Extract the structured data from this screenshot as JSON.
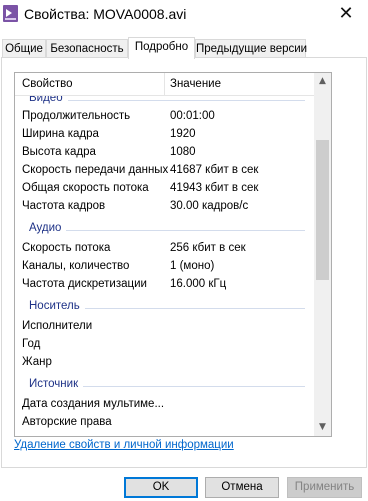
{
  "window": {
    "title": "Свойства: MOVA0008.avi"
  },
  "tabs": [
    "Общие",
    "Безопасность",
    "Подробно",
    "Предыдущие версии"
  ],
  "grid": {
    "col_property": "Свойство",
    "col_value": "Значение",
    "sections": {
      "video": "Видео",
      "audio": "Аудио",
      "media": "Носитель",
      "source": "Источник"
    },
    "video": [
      {
        "p": "Продолжительность",
        "v": "00:01:00"
      },
      {
        "p": "Ширина кадра",
        "v": "1920"
      },
      {
        "p": "Высота кадра",
        "v": "1080"
      },
      {
        "p": "Скорость передачи данных",
        "v": "41687 кбит в сек"
      },
      {
        "p": "Общая скорость потока",
        "v": "41943 кбит в сек"
      },
      {
        "p": "Частота кадров",
        "v": "30.00 кадров/с"
      }
    ],
    "audio": [
      {
        "p": "Скорость потока",
        "v": "256 кбит в сек"
      },
      {
        "p": "Каналы, количество",
        "v": "1 (моно)"
      },
      {
        "p": "Частота дискретизации",
        "v": "16.000 кГц"
      }
    ],
    "media": [
      {
        "p": "Исполнители",
        "v": ""
      },
      {
        "p": "Год",
        "v": ""
      },
      {
        "p": "Жанр",
        "v": ""
      }
    ],
    "source": [
      {
        "p": "Дата создания мультиме...",
        "v": ""
      },
      {
        "p": "Авторские права",
        "v": ""
      }
    ]
  },
  "remove_link": "Удаление свойств и личной информации",
  "buttons": {
    "ok": "OK",
    "cancel": "Отмена",
    "apply": "Применить"
  }
}
